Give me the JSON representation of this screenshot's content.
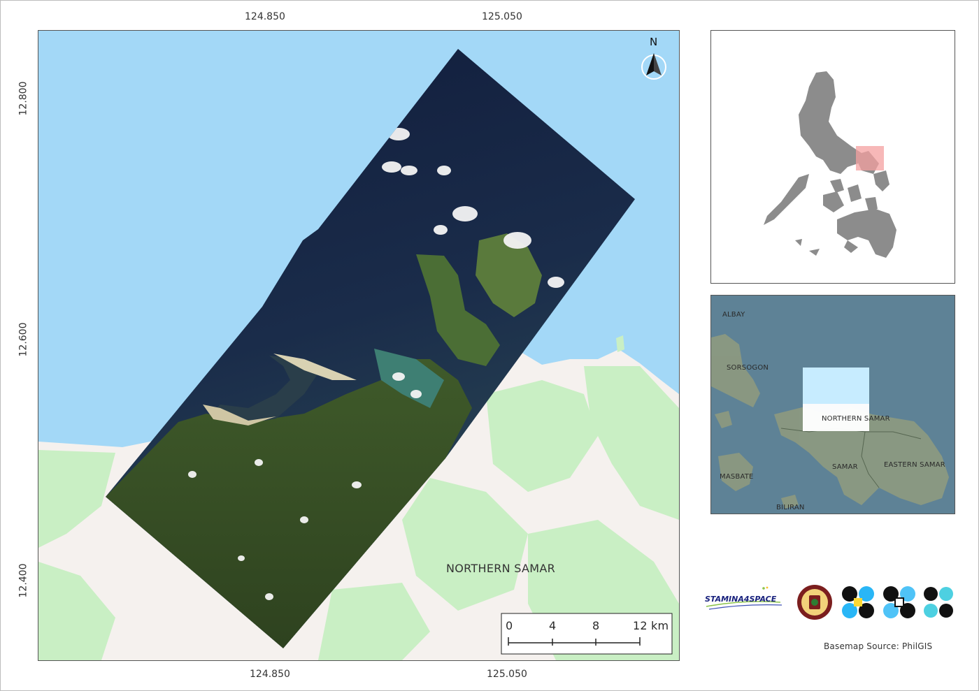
{
  "map": {
    "grid_ticks_top": [
      "124.850",
      "125.050"
    ],
    "grid_ticks_bottom": [
      "124.850",
      "125.050"
    ],
    "grid_ticks_left": [
      "12.800",
      "12.600",
      "12.400"
    ],
    "region_label": "NORTHERN SAMAR",
    "north_label": "N",
    "scale": {
      "labels": [
        "0",
        "4",
        "8",
        "12 km"
      ]
    },
    "colors": {
      "sea": "#a3d8f7",
      "land": "#f5f1ee",
      "veg": "#c9efc4"
    }
  },
  "locator_map": {
    "highlight_color": "#f4a0a0",
    "land_color": "#8c8c8c"
  },
  "context_map": {
    "labels": [
      "ALBAY",
      "SORSOGON",
      "NORTHERN SAMAR",
      "SAMAR",
      "EASTERN SAMAR",
      "MASBATE",
      "BILIRAN"
    ]
  },
  "logos": {
    "stamina_text": "STAMINA4SPACE"
  },
  "basemap_source": "Basemap Source: PhilGIS"
}
